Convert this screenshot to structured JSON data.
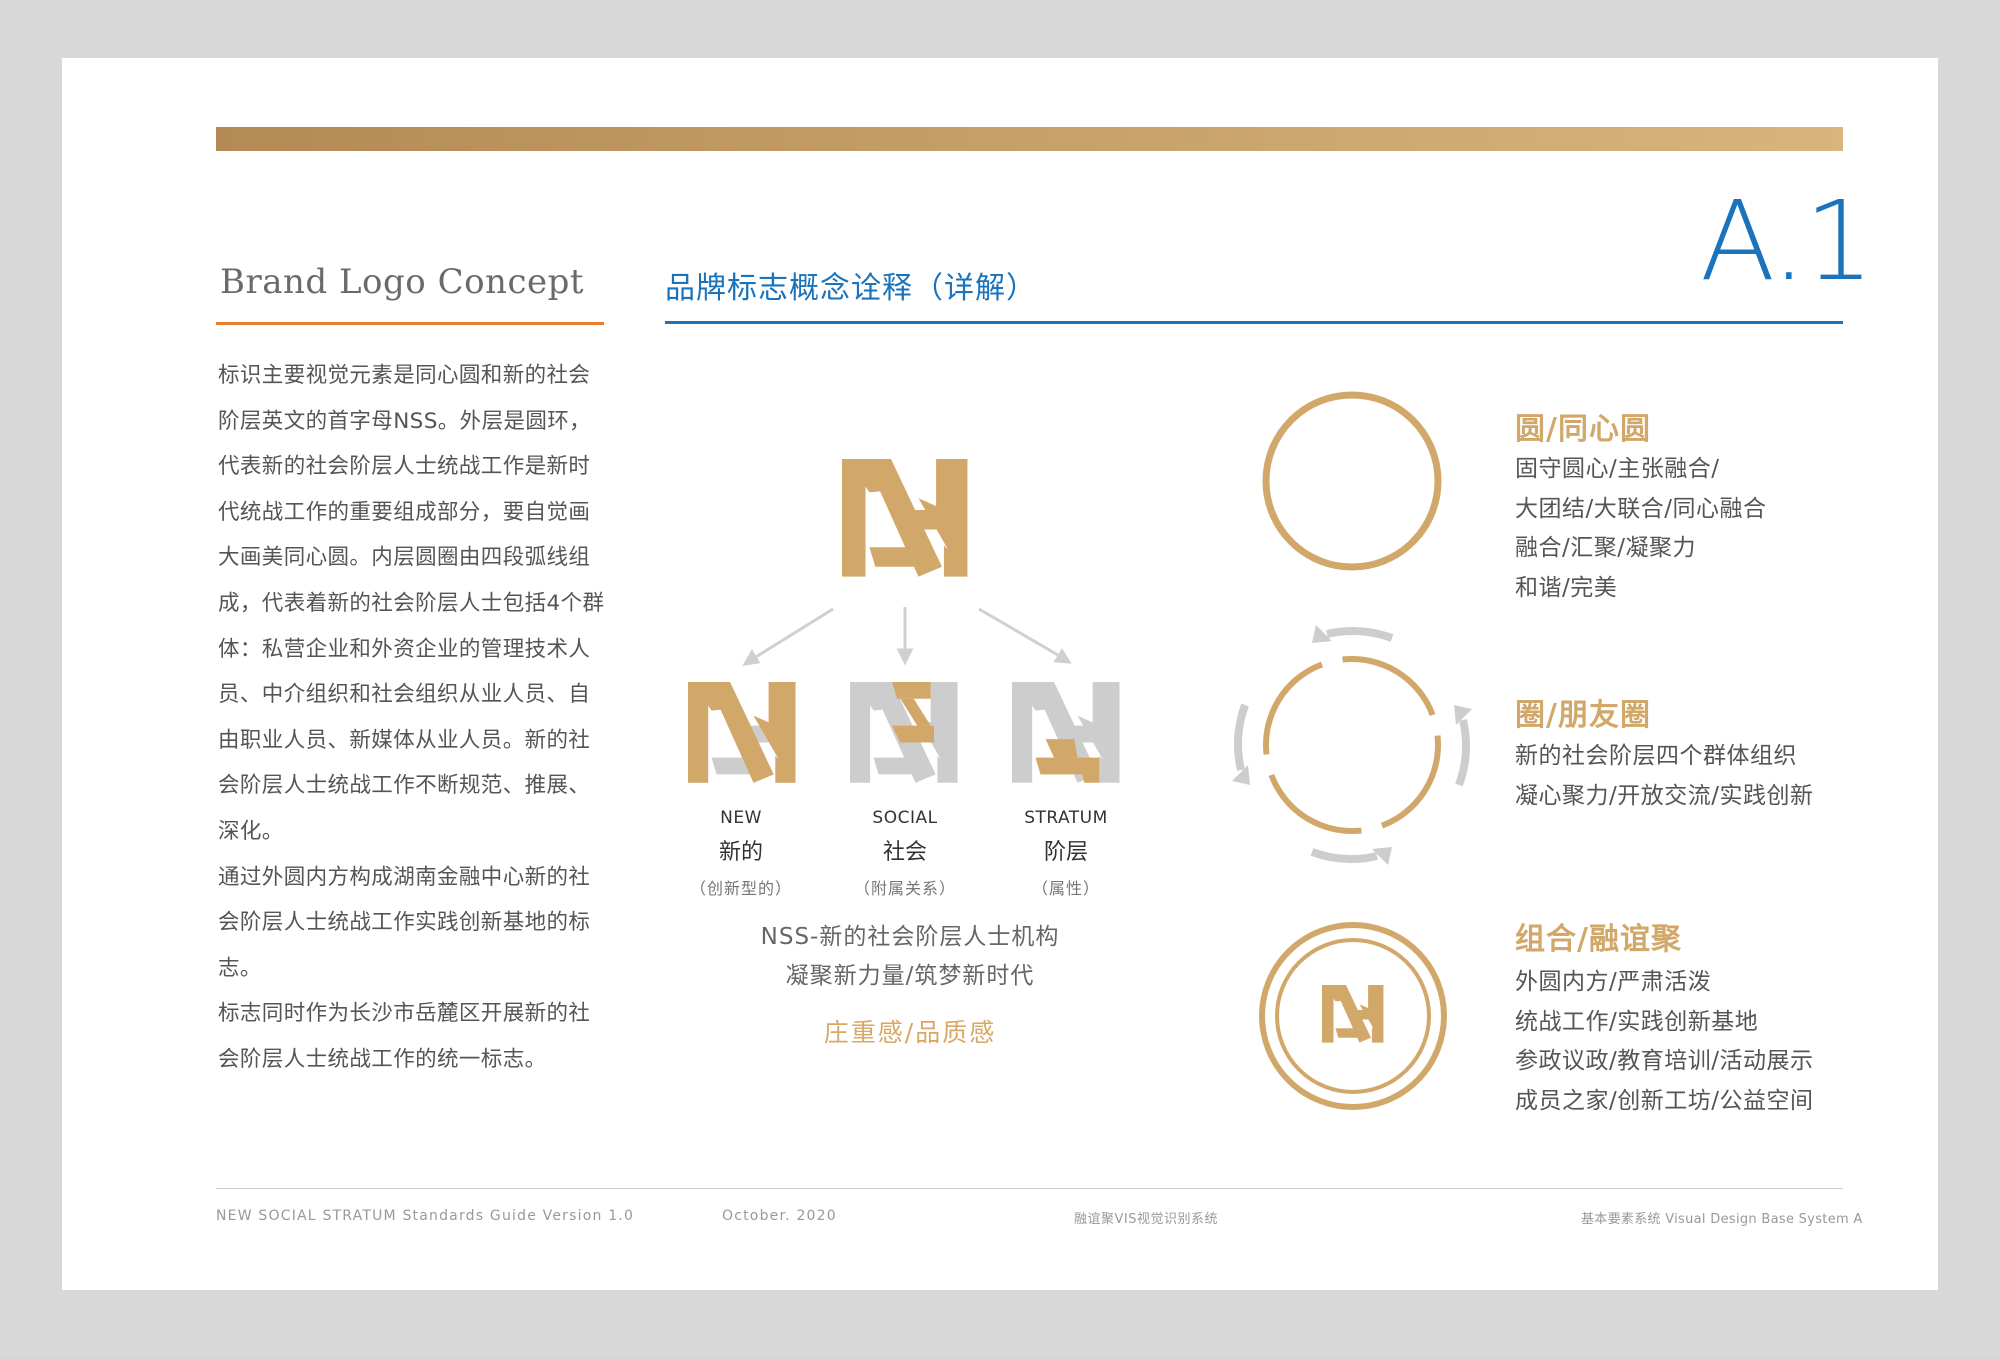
{
  "header": {
    "page_number": "A.1",
    "brand_title": "Brand Logo Concept",
    "section_title": "品牌标志概念诠释（详解）"
  },
  "description": {
    "paragraphs": [
      "标识主要视觉元素是同心圆和新的社会阶层英文的首字母NSS。外层是圆环，代表新的社会阶层人士统战工作是新时代统战工作的重要组成部分，要自觉画大画美同心圆。内层圆圈由四段弧线组成，代表着新的社会阶层人士包括4个群体：私营企业和外资企业的管理技术人员、中介组织和社会组织从业人员、自由职业人员、新媒体从业人员。新的社会阶层人士统战工作不断规范、推展、深化。",
      "通过外圆内方构成湖南金融中心新的社会阶层人士统战工作实践创新基地的标志。",
      "标志同时作为长沙市岳麓区开展新的社会阶层人士统战工作的统一标志。"
    ]
  },
  "logo_breakdown": {
    "items": [
      {
        "en": "NEW",
        "cn": "新的",
        "note": "（创新型的）"
      },
      {
        "en": "SOCIAL",
        "cn": "社会",
        "note": "（附属关系）"
      },
      {
        "en": "STRATUM",
        "cn": "阶层",
        "note": "（属性）"
      }
    ],
    "caption_line1": "NSS-新的社会阶层人士机构",
    "caption_line2": "凝聚新力量/筑梦新时代",
    "tagline": "庄重感/品质感"
  },
  "concepts": [
    {
      "title": "圆/同心圆",
      "lines": [
        "固守圆心/主张融合/",
        "大团结/大联合/同心融合",
        "融合/汇聚/凝聚力",
        "和谐/完美"
      ]
    },
    {
      "title": "圈/朋友圈",
      "lines": [
        "新的社会阶层四个群体组织",
        "凝心聚力/开放交流/实践创新"
      ]
    },
    {
      "title": "组合/融谊聚",
      "lines": [
        "外圆内方/严肃活泼",
        "统战工作/实践创新基地",
        "参政议政/教育培训/活动展示",
        "成员之家/创新工坊/公益空间"
      ]
    }
  ],
  "footer": {
    "guide": "NEW SOCIAL STRATUM Standards Guide Version 1.0",
    "date": "October. 2020",
    "system_cn": "融谊聚VIS视觉识别系统",
    "system_en": "基本要素系统  Visual  Design Base  System  A"
  },
  "colors": {
    "gold": "#d2a86a",
    "blue": "#1a73bb",
    "orange_rule": "#e87d2d",
    "gray": "#cdcdcd"
  },
  "icons": [
    "nss-logo-icon",
    "concentric-circle-icon",
    "segmented-circle-icon",
    "combined-emblem-icon",
    "arrow-icon"
  ]
}
